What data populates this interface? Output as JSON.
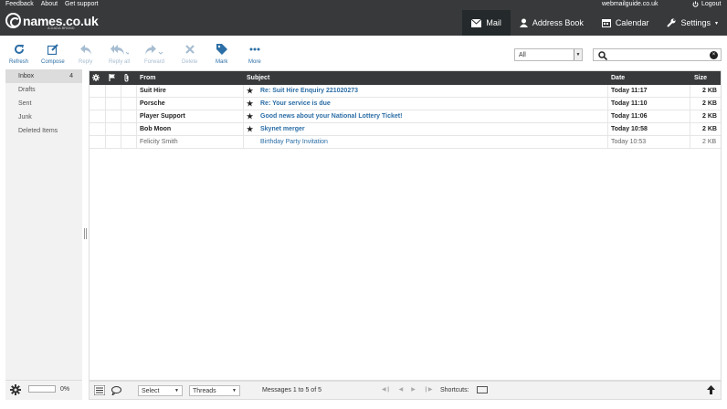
{
  "topbar": {
    "links": [
      "Feedback",
      "About",
      "Get support"
    ],
    "host": "webmailguide.co.uk",
    "logout": "Logout"
  },
  "brand": {
    "name": "names.co.uk",
    "tagline": "A DADA BRAND"
  },
  "nav": [
    {
      "label": "Mail",
      "icon": "mail-icon",
      "active": true
    },
    {
      "label": "Address Book",
      "icon": "person-icon",
      "active": false
    },
    {
      "label": "Calendar",
      "icon": "calendar-icon",
      "active": false
    },
    {
      "label": "Settings",
      "icon": "wrench-icon",
      "active": false
    }
  ],
  "toolbar": {
    "refresh": "Refresh",
    "compose": "Compose",
    "reply": "Reply",
    "reply_all": "Reply all",
    "forward": "Forward",
    "delete": "Delete",
    "mark": "Mark",
    "more": "More"
  },
  "filter": {
    "selected": "All"
  },
  "search": {
    "value": ""
  },
  "folders": [
    {
      "name": "Inbox",
      "count": "4",
      "active": true
    },
    {
      "name": "Drafts",
      "count": "",
      "active": false
    },
    {
      "name": "Sent",
      "count": "",
      "active": false
    },
    {
      "name": "Junk",
      "count": "",
      "active": false
    },
    {
      "name": "Deleted Items",
      "count": "",
      "active": false
    }
  ],
  "quota": {
    "percent": "0%",
    "fraction": 0
  },
  "list": {
    "columns": {
      "from": "From",
      "subject": "Subject",
      "date": "Date",
      "size": "Size"
    },
    "messages": [
      {
        "from": "Suit Hire",
        "subject": "Re: Suit Hire Enquiry 221020273",
        "date": "Today 11:17",
        "size": "2 KB",
        "unread": true,
        "flagged": true
      },
      {
        "from": "Porsche",
        "subject": "Re: Your service is due",
        "date": "Today 11:10",
        "size": "2 KB",
        "unread": true,
        "flagged": true
      },
      {
        "from": "Player Support",
        "subject": "Good news about your National Lottery Ticket!",
        "date": "Today 11:06",
        "size": "2 KB",
        "unread": true,
        "flagged": true
      },
      {
        "from": "Bob Moon",
        "subject": "Skynet merger",
        "date": "Today 10:58",
        "size": "2 KB",
        "unread": true,
        "flagged": true
      },
      {
        "from": "Felicity Smith",
        "subject": "Birthday Party Invitation",
        "date": "Today 10:53",
        "size": "2 KB",
        "unread": false,
        "flagged": false
      }
    ]
  },
  "footer": {
    "select_label": "Select",
    "threads_label": "Threads",
    "count_text": "Messages 1 to 5 of 5",
    "shortcuts_label": "Shortcuts:"
  },
  "colors": {
    "header_bg": "#37393b",
    "active_nav_bg": "#24292b",
    "link_blue": "#2c6ea6",
    "sidebar_bg": "#f2f2f2"
  }
}
